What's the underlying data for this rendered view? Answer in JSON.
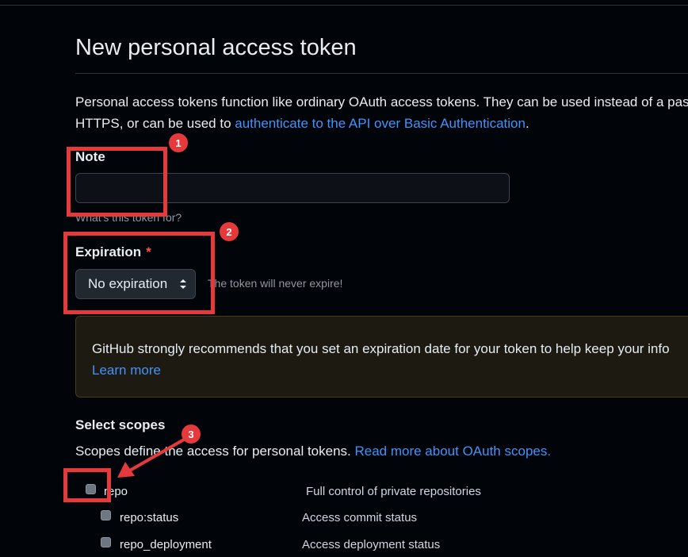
{
  "page": {
    "title": "New personal access token",
    "intro_text": "Personal access tokens function like ordinary OAuth access tokens. They can be used instead of a pas",
    "intro_text_2": "HTTPS, or can be used to ",
    "intro_link": "authenticate to the API over Basic Authentication",
    "intro_end": "."
  },
  "note": {
    "label": "Note",
    "value": "",
    "placeholder": "",
    "hint": "What's this token for?"
  },
  "expiration": {
    "label": "Expiration",
    "required_mark": "*",
    "selected": "No expiration",
    "hint": "The token will never expire!"
  },
  "warning": {
    "text": "GitHub strongly recommends that you set an expiration date for your token to help keep your info",
    "link": "Learn more"
  },
  "scopes": {
    "heading": "Select scopes",
    "description": "Scopes define the access for personal tokens. ",
    "link": "Read more about OAuth scopes.",
    "items": [
      {
        "name": "repo",
        "description": "Full control of private repositories",
        "checked": false
      },
      {
        "name": "repo:status",
        "description": "Access commit status",
        "checked": false
      },
      {
        "name": "repo_deployment",
        "description": "Access deployment status",
        "checked": false
      }
    ]
  },
  "annotations": {
    "badge_1": "1",
    "badge_2": "2",
    "badge_3": "3"
  },
  "colors": {
    "background": "#010409",
    "link": "#4493f8",
    "annotation_red": "#e5393b",
    "required_red": "#f85149",
    "warning_bg": "#1d1a12",
    "warning_border": "#4d3b14"
  }
}
